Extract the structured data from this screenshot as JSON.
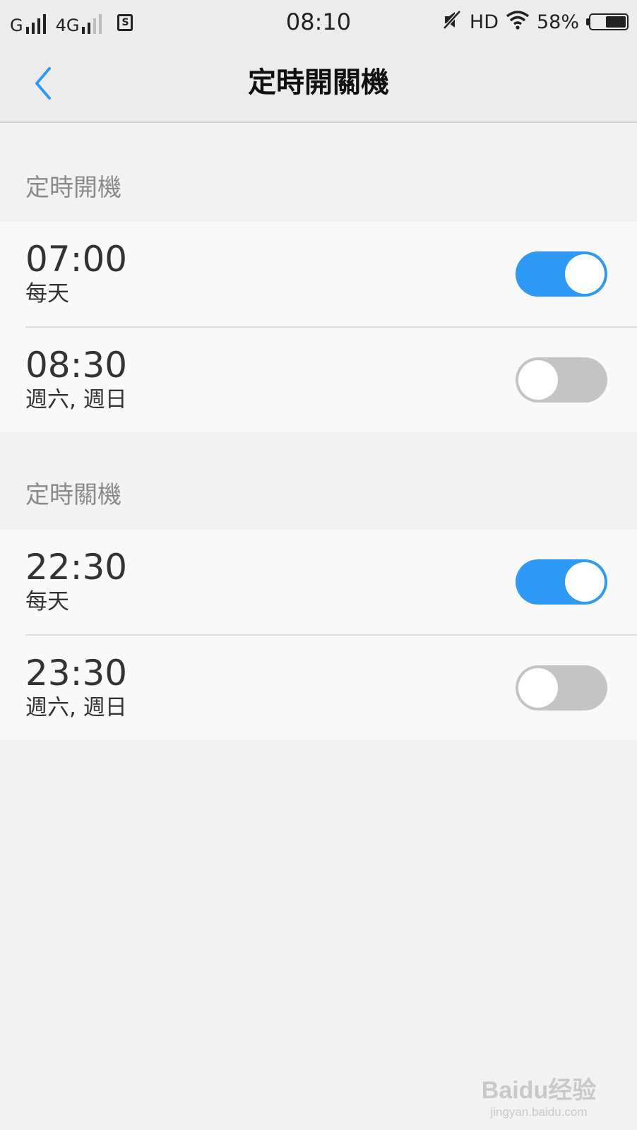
{
  "status_bar": {
    "carrier1": "G",
    "carrier2": "4G",
    "sim_label": "S",
    "time": "08:10",
    "hd": "HD",
    "battery_pct": "58%",
    "battery_level": 0.58
  },
  "header": {
    "title": "定時開關機"
  },
  "sections": [
    {
      "header": "定時開機",
      "items": [
        {
          "time": "07:00",
          "repeat": "每天",
          "enabled": true
        },
        {
          "time": "08:30",
          "repeat": "週六, 週日",
          "enabled": false
        }
      ]
    },
    {
      "header": "定時關機",
      "items": [
        {
          "time": "22:30",
          "repeat": "每天",
          "enabled": true
        },
        {
          "time": "23:30",
          "repeat": "週六, 週日",
          "enabled": false
        }
      ]
    }
  ],
  "watermark": {
    "logo": "Baidu经验",
    "url": "jingyan.baidu.com"
  },
  "colors": {
    "accent": "#2f9af5",
    "toggle_off": "#c4c4c4"
  }
}
